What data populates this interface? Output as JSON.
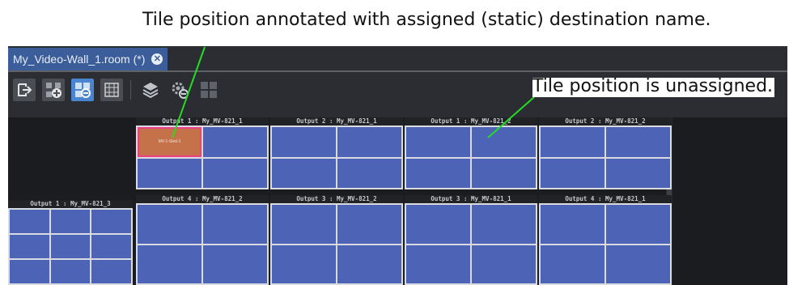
{
  "annotations": {
    "top": "Tile position annotated with assigned (static) destination name.",
    "right": "Tile position is unassigned."
  },
  "tab": {
    "label": "My_Video-Wall_1.room (*)",
    "close_glyph": "✕"
  },
  "toolbar": {
    "buttons": [
      {
        "name": "exit-icon",
        "active": false
      },
      {
        "name": "add-monitor-icon",
        "active": false
      },
      {
        "name": "assign-layout-icon",
        "active": true
      },
      {
        "name": "grid-icon",
        "active": false
      },
      {
        "name": "layers-icon",
        "active": false
      },
      {
        "name": "settings-icon",
        "active": false
      },
      {
        "name": "tiles-icon",
        "active": false
      }
    ]
  },
  "monitors": [
    {
      "title": "Output 1 : My_MV-821_1",
      "rows": 2,
      "cols": 2,
      "assigned_tile": 0,
      "assigned_label": "MV-1-Sled-1"
    },
    {
      "title": "Output 2 : My_MV-821_1",
      "rows": 2,
      "cols": 2
    },
    {
      "title": "Output 1 : My_MV-821_2",
      "rows": 2,
      "cols": 2
    },
    {
      "title": "Output 2 : My_MV-821_2",
      "rows": 2,
      "cols": 2
    },
    {
      "title": "Output 4 : My_MV-821_2",
      "rows": 2,
      "cols": 2
    },
    {
      "title": "Output 3 : My_MV-821_2",
      "rows": 2,
      "cols": 2
    },
    {
      "title": "Output 3 : My_MV-821_1",
      "rows": 2,
      "cols": 2
    },
    {
      "title": "Output 4 : My_MV-821_1",
      "rows": 2,
      "cols": 2
    },
    {
      "title": "Output 1 : My_MV-821_3",
      "rows": 3,
      "cols": 3
    }
  ],
  "colors": {
    "tile": "#4d63b6",
    "assigned_tile": "#c5714a",
    "assigned_border": "#e94088",
    "leader_line": "#22dd22"
  }
}
